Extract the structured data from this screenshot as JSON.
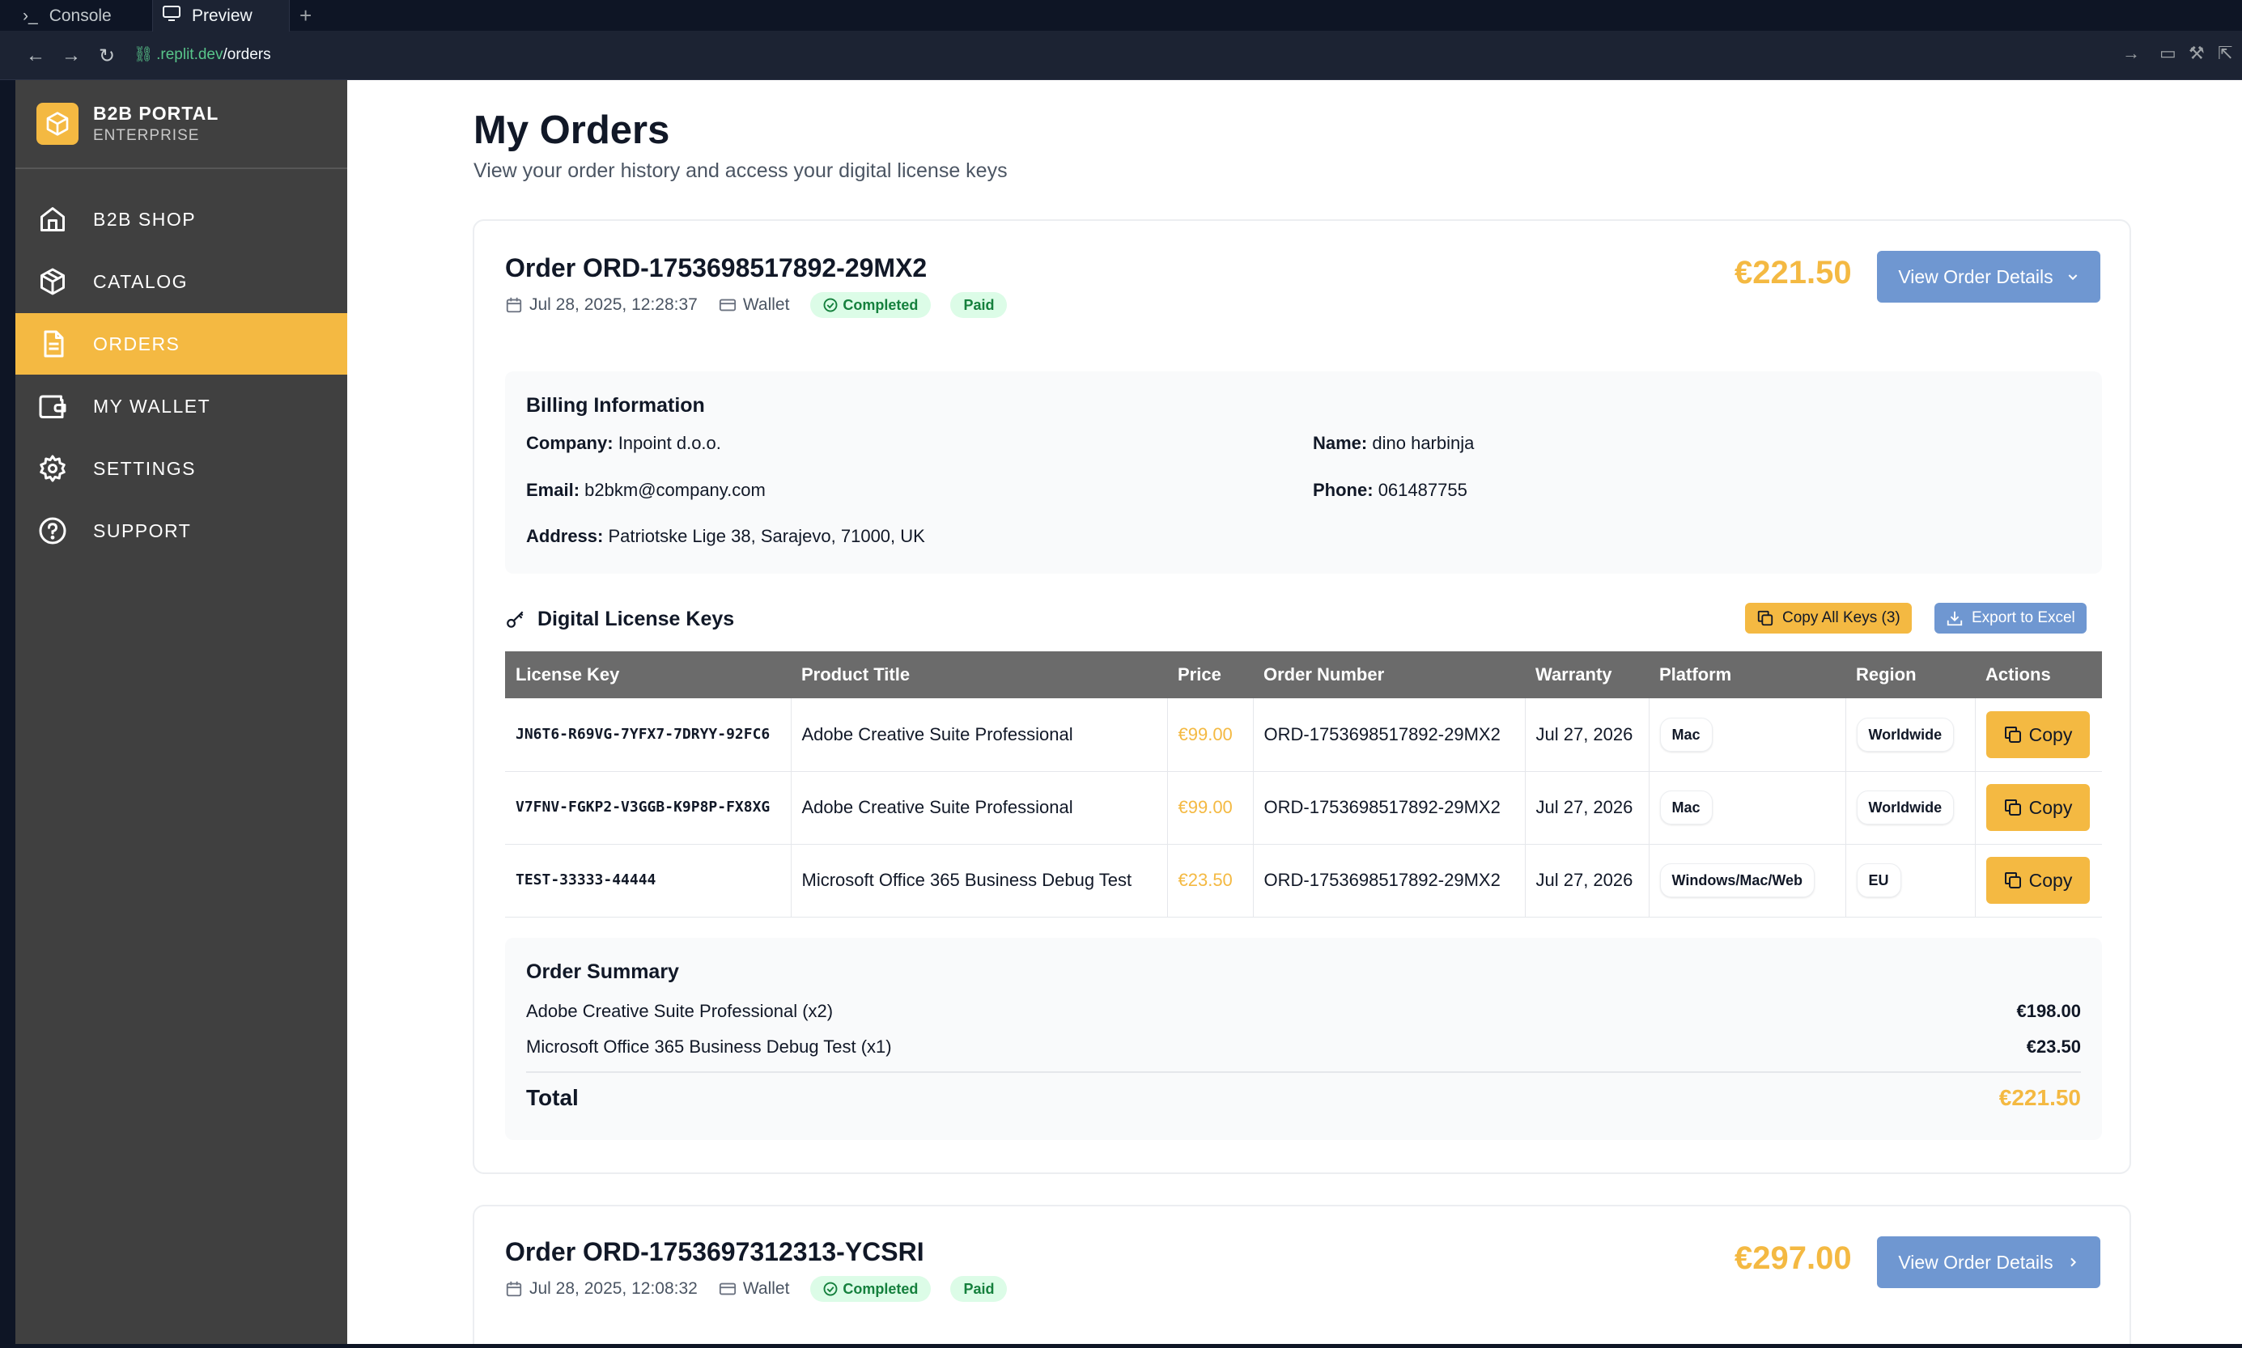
{
  "browser": {
    "tabs": [
      {
        "label": "Console"
      },
      {
        "label": "Preview"
      }
    ],
    "url_prefix": ".replit.dev",
    "url_path": "/orders"
  },
  "sidebar": {
    "brand_title": "B2B PORTAL",
    "brand_subtitle": "ENTERPRISE",
    "items": [
      {
        "label": "B2B SHOP",
        "icon": "home-icon"
      },
      {
        "label": "CATALOG",
        "icon": "box-icon"
      },
      {
        "label": "ORDERS",
        "icon": "document-icon",
        "active": true
      },
      {
        "label": "MY WALLET",
        "icon": "wallet-icon"
      },
      {
        "label": "SETTINGS",
        "icon": "gear-icon"
      },
      {
        "label": "SUPPORT",
        "icon": "help-circle-icon"
      }
    ]
  },
  "page": {
    "title": "My Orders",
    "subtitle": "View your order history and access your digital license keys"
  },
  "orders": [
    {
      "title": "Order ORD-1753698517892-29MX2",
      "date": "Jul 28, 2025, 12:28:37",
      "payment": "Wallet",
      "status": "Completed",
      "payment_status": "Paid",
      "total": "€221.50",
      "view_label": "View Order Details",
      "billing": {
        "title": "Billing Information",
        "company_label": "Company:",
        "company": "Inpoint d.o.o.",
        "name_label": "Name:",
        "name": "dino harbinja",
        "email_label": "Email:",
        "email": "b2bkm@company.com",
        "phone_label": "Phone:",
        "phone": "061487755",
        "address_label": "Address:",
        "address": "Patriotske Lige 38, Sarajevo, 71000, UK"
      },
      "keys_title": "Digital License Keys",
      "copy_all_label": "Copy All Keys (3)",
      "export_label": "Export to Excel",
      "table_headers": [
        "License Key",
        "Product Title",
        "Price",
        "Order Number",
        "Warranty",
        "Platform",
        "Region",
        "Actions"
      ],
      "keys": [
        {
          "key": "JN6T6-R69VG-7YFX7-7DRYY-92FC6",
          "product": "Adobe Creative Suite Professional",
          "price": "€99.00",
          "order_number": "ORD-1753698517892-29MX2",
          "warranty": "Jul 27, 2026",
          "platform": "Mac",
          "region": "Worldwide",
          "action": "Copy"
        },
        {
          "key": "V7FNV-FGKP2-V3GGB-K9P8P-FX8XG",
          "product": "Adobe Creative Suite Professional",
          "price": "€99.00",
          "order_number": "ORD-1753698517892-29MX2",
          "warranty": "Jul 27, 2026",
          "platform": "Mac",
          "region": "Worldwide",
          "action": "Copy"
        },
        {
          "key": "TEST-33333-44444",
          "product": "Microsoft Office 365 Business Debug Test",
          "price": "€23.50",
          "order_number": "ORD-1753698517892-29MX2",
          "warranty": "Jul 27, 2026",
          "platform": "Windows/Mac/Web",
          "region": "EU",
          "action": "Copy"
        }
      ],
      "summary": {
        "title": "Order Summary",
        "lines": [
          {
            "label": "Adobe Creative Suite Professional (x2)",
            "amount": "€198.00"
          },
          {
            "label": "Microsoft Office 365 Business Debug Test (x1)",
            "amount": "€23.50"
          }
        ],
        "total_label": "Total",
        "total": "€221.50"
      }
    },
    {
      "title": "Order ORD-1753697312313-YCSRI",
      "date": "Jul 28, 2025, 12:08:32",
      "payment": "Wallet",
      "status": "Completed",
      "payment_status": "Paid",
      "total": "€297.00",
      "view_label": "View Order Details"
    }
  ],
  "colors": {
    "accent": "#f4b942",
    "sidebar": "#404040",
    "button_blue": "#6f97d1",
    "status_green": "#15803d"
  }
}
